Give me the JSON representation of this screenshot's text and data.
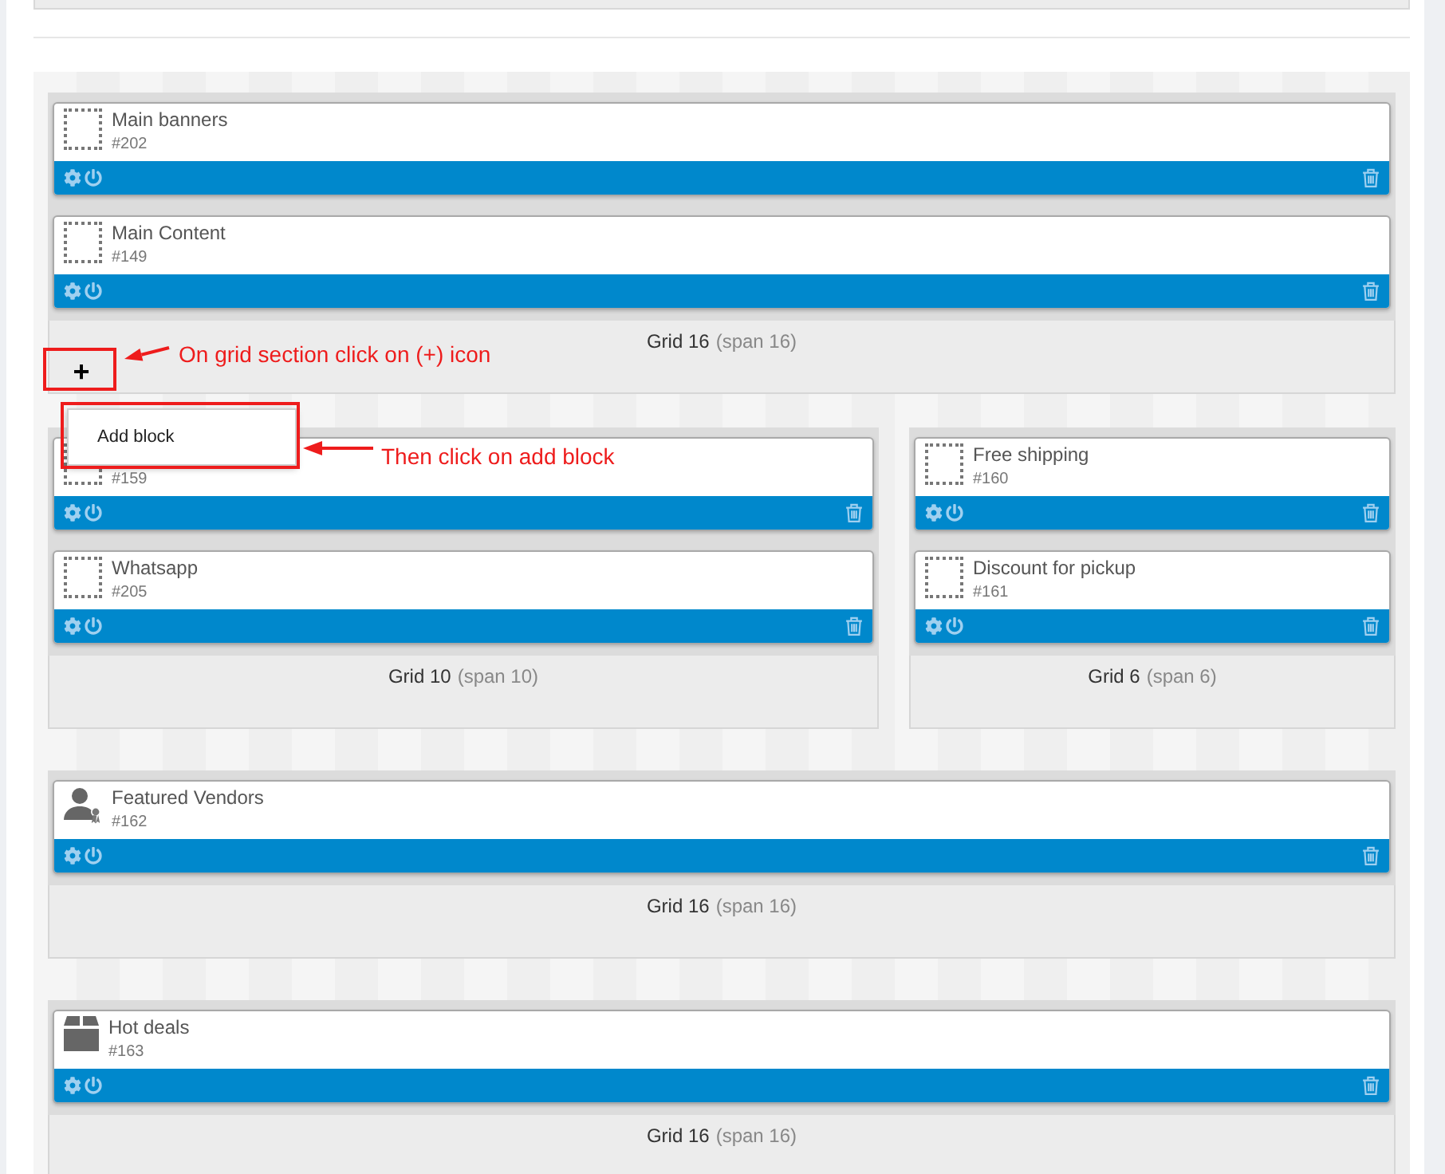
{
  "grid_rows": [
    {
      "grids": [
        {
          "label": "Grid 16",
          "span": "(span 16)",
          "add_button": "+",
          "blocks": [
            {
              "kind": "empty",
              "title": "Main banners",
              "number": "#202"
            },
            {
              "kind": "empty",
              "title": "Main Content",
              "number": "#149"
            }
          ]
        }
      ]
    },
    {
      "grids": [
        {
          "label": "Grid 10",
          "span": "(span 10)",
          "blocks": [
            {
              "kind": "empty",
              "number": "#159"
            },
            {
              "kind": "empty",
              "title": "Whatsapp",
              "number": "#205"
            }
          ]
        },
        {
          "label": "Grid 6",
          "span": "(span 6)",
          "blocks": [
            {
              "kind": "empty",
              "title": "Free shipping",
              "number": "#160"
            },
            {
              "kind": "empty",
              "title": "Discount for pickup",
              "number": "#161"
            }
          ]
        }
      ]
    },
    {
      "grids": [
        {
          "label": "Grid 16",
          "span": "(span 16)",
          "blocks": [
            {
              "kind": "vendor",
              "title": "Featured Vendors",
              "number": "#162"
            }
          ]
        }
      ]
    },
    {
      "grids": [
        {
          "label": "Grid 16",
          "span": "(span 16)",
          "blocks": [
            {
              "kind": "box",
              "title": "Hot deals",
              "number": "#163"
            }
          ]
        }
      ]
    }
  ],
  "popup_menu": {
    "items": [
      {
        "label": "Add block"
      }
    ]
  },
  "annotations": [
    {
      "text": "On grid section click on (+) icon"
    },
    {
      "text": "Then click on add block"
    }
  ]
}
